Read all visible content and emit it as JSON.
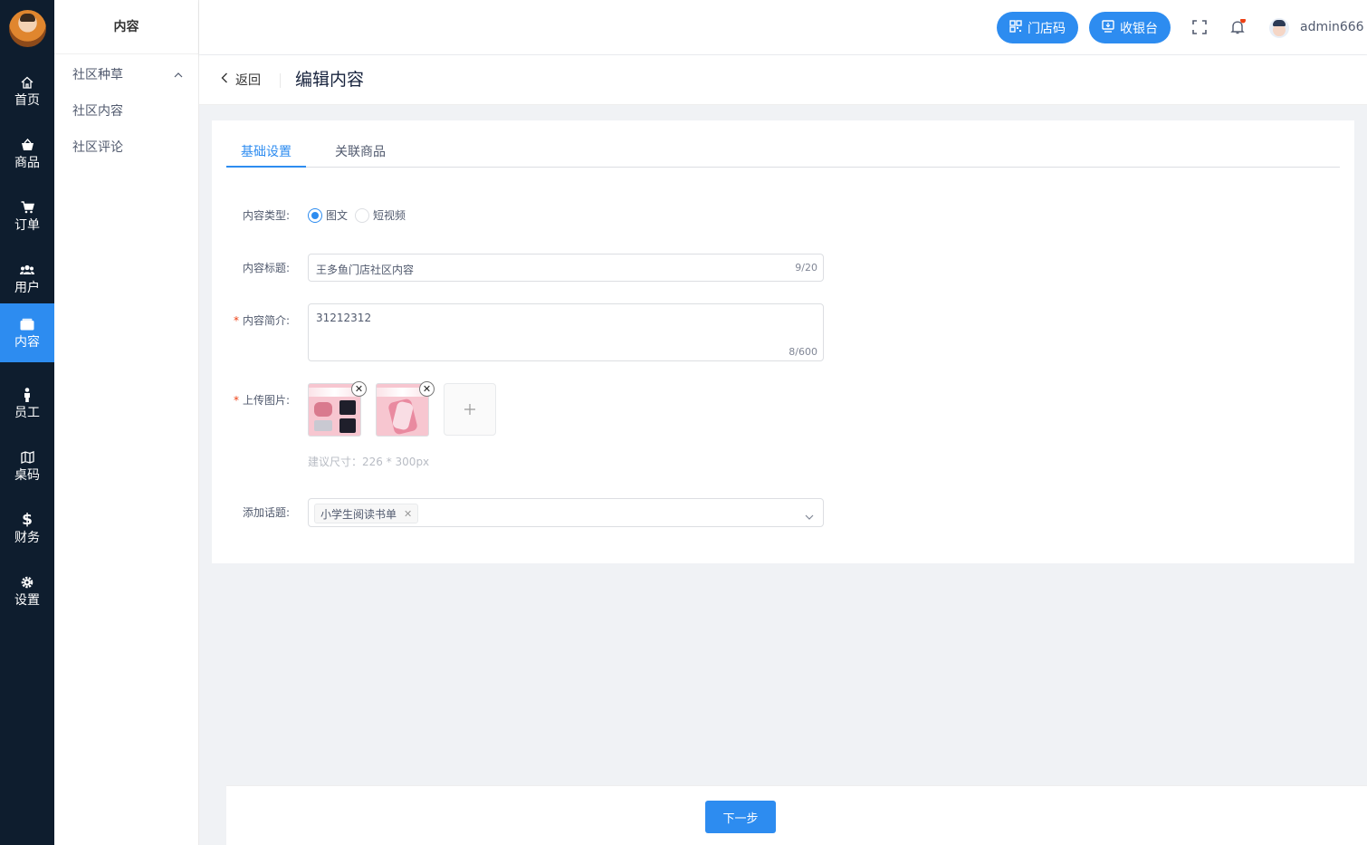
{
  "rail": {
    "items": [
      {
        "label": "首页",
        "icon": "home-icon"
      },
      {
        "label": "商品",
        "icon": "basket-icon"
      },
      {
        "label": "订单",
        "icon": "cart-icon"
      },
      {
        "label": "用户",
        "icon": "users-icon"
      },
      {
        "label": "内容",
        "icon": "content-icon"
      },
      {
        "label": "员工",
        "icon": "person-icon"
      },
      {
        "label": "桌码",
        "icon": "map-icon"
      },
      {
        "label": "财务",
        "icon": "dollar-icon"
      },
      {
        "label": "设置",
        "icon": "gear-icon"
      }
    ],
    "active_label": "内容"
  },
  "submenu": {
    "title": "内容",
    "group": "社区种草",
    "items": [
      "社区内容",
      "社区评论"
    ]
  },
  "header": {
    "store_code_btn": "门店码",
    "cashier_btn": "收银台",
    "username": "admin666",
    "accent": "#2d8cf0"
  },
  "titlebar": {
    "back": "返回",
    "title": "编辑内容"
  },
  "tabs": [
    "基础设置",
    "关联商品"
  ],
  "form": {
    "type_label": "内容类型:",
    "type_options": [
      "图文",
      "短视频"
    ],
    "type_selected": "图文",
    "title_label": "内容标题:",
    "title_value": "王多鱼门店社区内容",
    "title_count": "9/20",
    "intro_label": "内容简介:",
    "intro_value": "31212312",
    "intro_count": "8/600",
    "upload_label": "上传图片:",
    "upload_hint": "建议尺寸：226 * 300px",
    "topic_label": "添加话题:",
    "topic_tag": "小学生阅读书单"
  },
  "footer": {
    "next": "下一步"
  }
}
